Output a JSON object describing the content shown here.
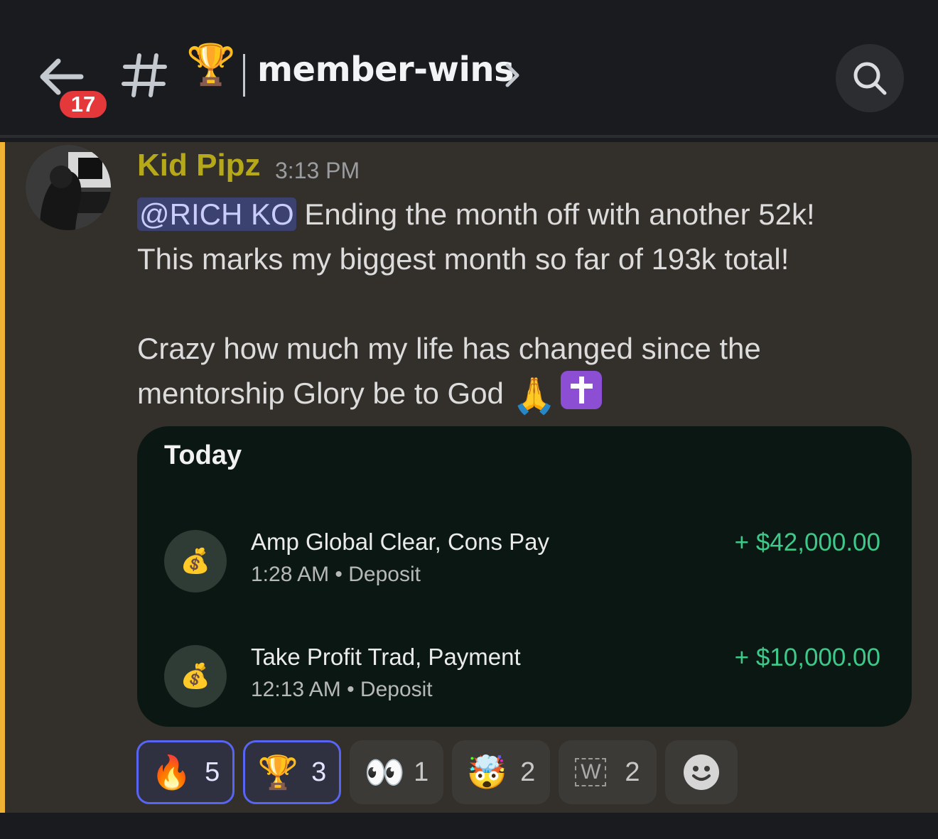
{
  "header": {
    "unread_count": "17",
    "channel_name": "member-wins",
    "channel_emoji": "🏆"
  },
  "message": {
    "author": "Kid Pipz",
    "timestamp": "3:13 PM",
    "mention": "@RICH KO",
    "line1_rest": " Ending the month off with another 52k!",
    "line2": "This marks my biggest month so far of 193k total!",
    "line3": "Crazy how much my life has changed since the",
    "line4": "mentorship Glory be to God ",
    "emoji_pray": "🙏",
    "author_color": "#b5a819"
  },
  "card": {
    "title": "Today",
    "transactions": [
      {
        "icon": "money-bag-icon",
        "title": "Amp Global Clear, Cons Pay",
        "subtitle": "1:28 AM • Deposit",
        "amount": "+ $42,000.00"
      },
      {
        "icon": "money-bag-icon",
        "title": "Take Profit Trad, Payment",
        "subtitle": "12:13 AM • Deposit",
        "amount": "+ $10,000.00"
      }
    ],
    "amount_color": "#3ec98a"
  },
  "reactions": [
    {
      "emoji": "🔥",
      "count": "5"
    },
    {
      "emoji": "🏆",
      "count": "3"
    },
    {
      "emoji": "👀",
      "count": "1"
    },
    {
      "emoji": "🤯",
      "count": "2"
    },
    {
      "emoji": "W",
      "count": "2"
    }
  ]
}
